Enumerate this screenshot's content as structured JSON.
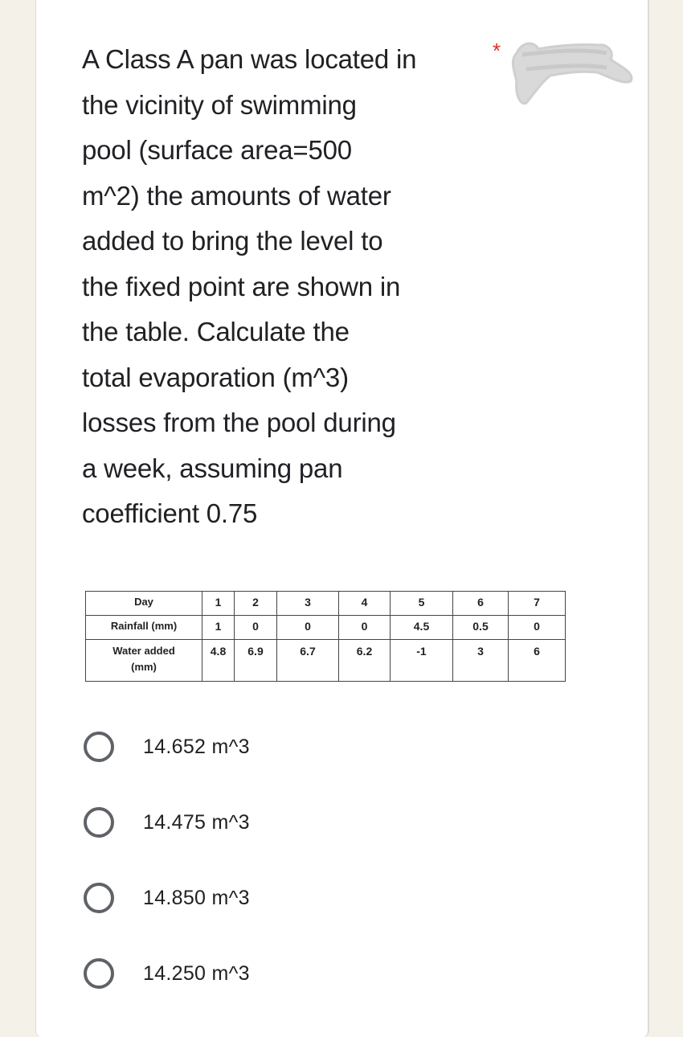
{
  "question": {
    "lines": [
      "A Class A pan was located in",
      "the vicinity of swimming",
      "pool (surface area=500",
      "m^2) the amounts of water",
      "added to bring the level to",
      "the fixed point are shown in",
      "the table.  Calculate the",
      "total evaporation (m^3)",
      "losses from the pool during",
      "a week, assuming pan",
      "coefficient 0.75"
    ],
    "required_marker": "*"
  },
  "table": {
    "rows": [
      {
        "header": "Day",
        "cells": [
          "1",
          "2",
          "3",
          "4",
          "5",
          "6",
          "7"
        ]
      },
      {
        "header": "Rainfall (mm)",
        "cells": [
          "1",
          "0",
          "0",
          "0",
          "4.5",
          "0.5",
          "0"
        ]
      },
      {
        "header": "Water added\n(mm)",
        "header_line1": "Water added",
        "header_line2": "(mm)",
        "cells": [
          "4.8",
          "6.9",
          "6.7",
          "6.2",
          "-1",
          "3",
          "6"
        ]
      }
    ]
  },
  "options": [
    {
      "label": "14.652 m^3",
      "selected": false
    },
    {
      "label": "14.475 m^3",
      "selected": false
    },
    {
      "label": "14.850 m^3",
      "selected": false
    },
    {
      "label": "14.250 m^3",
      "selected": false
    }
  ],
  "colors": {
    "background": "#f4f1e8",
    "card": "#ffffff",
    "text": "#202124",
    "required": "#d93025",
    "radio": "#5f6368",
    "redaction": "#d9d9d9"
  }
}
